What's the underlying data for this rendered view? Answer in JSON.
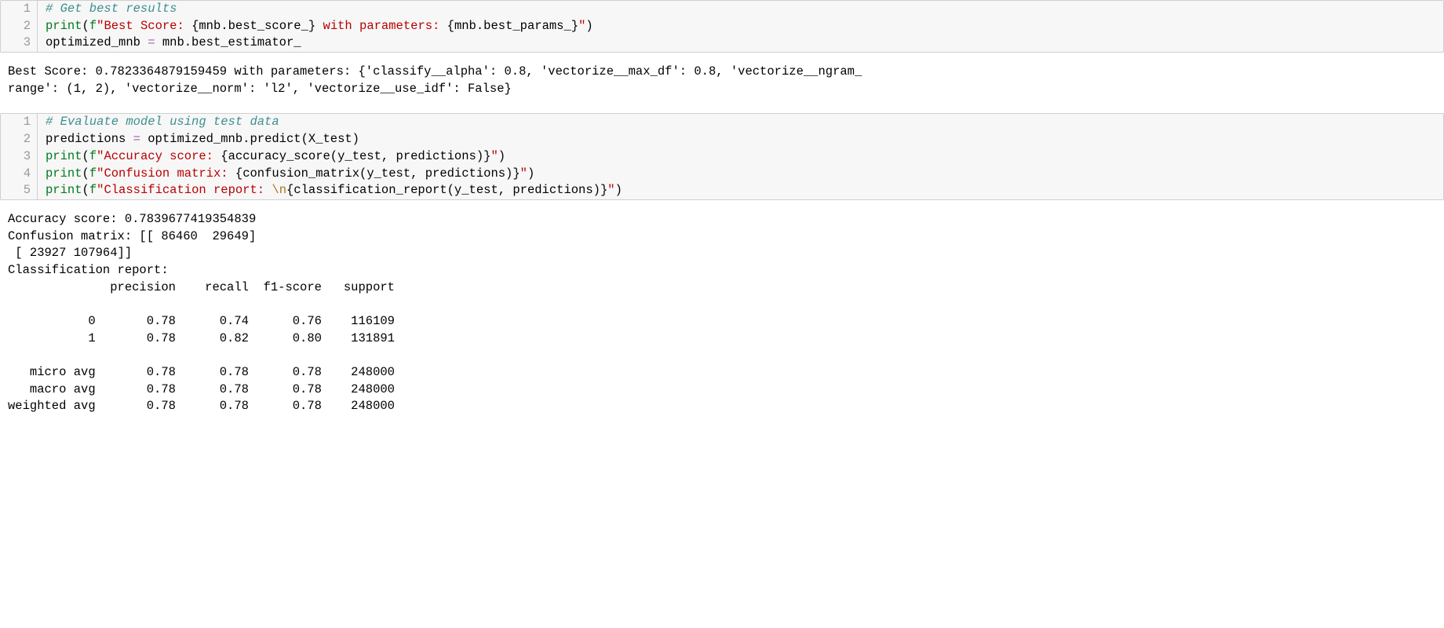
{
  "cell1": {
    "lines": [
      "1",
      "2",
      "3"
    ],
    "comment": "# Get best results",
    "print": "print",
    "f_prefix": "f",
    "q": "\"",
    "s1_a": "Best Score: ",
    "s1_b": " with parameters: ",
    "expr1": "{mnb.best_score_}",
    "expr2": "{mnb.best_params_}",
    "paren_open": "(",
    "paren_close": ")",
    "line3_lhs": "optimized_mnb ",
    "line3_op": "=",
    "line3_rhs": " mnb.best_estimator_"
  },
  "out1": "Best Score: 0.7823364879159459 with parameters: {'classify__alpha': 0.8, 'vectorize__max_df': 0.8, 'vectorize__ngram_\nrange': (1, 2), 'vectorize__norm': 'l2', 'vectorize__use_idf': False}",
  "cell2": {
    "lines": [
      "1",
      "2",
      "3",
      "4",
      "5"
    ],
    "comment": "# Evaluate model using test data",
    "l2_lhs": "predictions ",
    "l2_op": "=",
    "l2_rhs": " optimized_mnb.predict(X_test)",
    "print": "print",
    "f_prefix": "f",
    "q": "\"",
    "paren_open": "(",
    "paren_close": ")",
    "s3": "Accuracy score: ",
    "e3": "{accuracy_score(y_test, predictions)}",
    "s4": "Confusion matrix: ",
    "e4": "{confusion_matrix(y_test, predictions)}",
    "s5a": "Classification report: ",
    "esc5": "\\n",
    "e5": "{classification_report(y_test, predictions)}"
  },
  "out2": "Accuracy score: 0.7839677419354839\nConfusion matrix: [[ 86460  29649]\n [ 23927 107964]]\nClassification report: \n              precision    recall  f1-score   support\n\n           0       0.78      0.74      0.76    116109\n           1       0.78      0.82      0.80    131891\n\n   micro avg       0.78      0.78      0.78    248000\n   macro avg       0.78      0.78      0.78    248000\nweighted avg       0.78      0.78      0.78    248000\n"
}
